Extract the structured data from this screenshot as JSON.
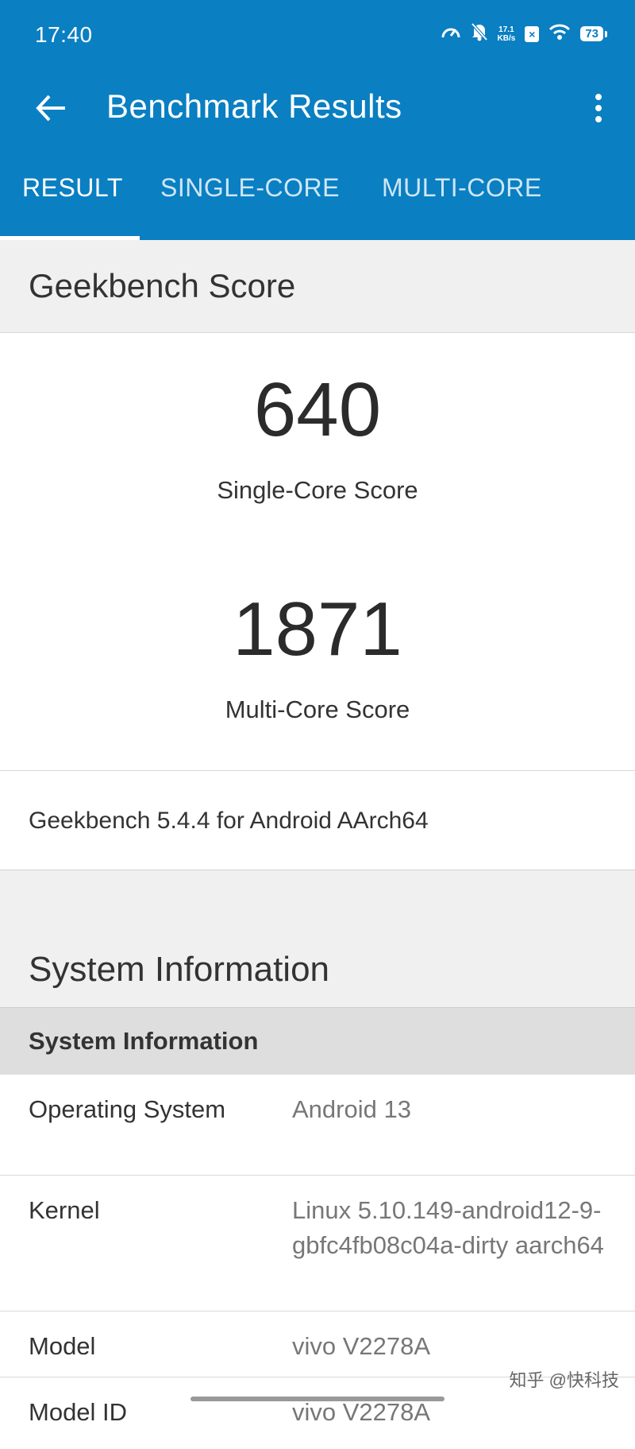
{
  "status_bar": {
    "time": "17:40",
    "net_speed_value": "17.1",
    "net_speed_unit": "KB/s",
    "battery": "73",
    "icons": [
      "speedometer-icon",
      "mute-bell-icon",
      "x-box-icon",
      "wifi-icon",
      "battery-icon"
    ]
  },
  "toolbar": {
    "title": "Benchmark  Results",
    "back_icon": "arrow-left-icon",
    "more_icon": "more-vert-icon"
  },
  "tabs": [
    {
      "label": "RESULT",
      "active": true
    },
    {
      "label": "SINGLE-CORE",
      "active": false
    },
    {
      "label": "MULTI-CORE",
      "active": false
    }
  ],
  "geekbench": {
    "header": "Geekbench Score",
    "single_core_score": "640",
    "single_core_label": "Single-Core Score",
    "multi_core_score": "1871",
    "multi_core_label": "Multi-Core Score",
    "version": "Geekbench 5.4.4 for Android AArch64"
  },
  "system_info": {
    "header": "System Information",
    "table_header": "System Information",
    "rows": [
      {
        "key": "Operating System",
        "value": "Android 13"
      },
      {
        "key": "Kernel",
        "value": "Linux 5.10.149-android12-9-gbfc4fb08c04a-dirty aarch64"
      },
      {
        "key": "Model",
        "value": "vivo V2278A"
      },
      {
        "key": "Model ID",
        "value": "vivo V2278A"
      }
    ]
  },
  "watermark": "知乎 @快科技",
  "colors": {
    "accent": "#0a7fc2",
    "header_bg": "#f0f0f0",
    "table_header_bg": "#dedede"
  }
}
